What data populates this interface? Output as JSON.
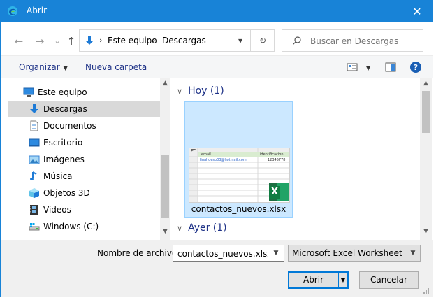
{
  "titlebar": {
    "title": "Abrir",
    "close": "✕"
  },
  "navigation": {
    "back": "←",
    "forward": "→",
    "recent": "⌄",
    "up": "↑",
    "breadcrumb": [
      "Este equipo",
      "Descargas"
    ],
    "breadcrumb_sep": "›",
    "refresh": "↻"
  },
  "search": {
    "placeholder": "Buscar en Descargas"
  },
  "toolbar": {
    "organize": "Organizar",
    "new_folder": "Nueva carpeta"
  },
  "tree": {
    "items": [
      {
        "label": "Este equipo",
        "icon": "computer-icon"
      },
      {
        "label": "Descargas",
        "icon": "downloads-icon"
      },
      {
        "label": "Documentos",
        "icon": "documents-icon"
      },
      {
        "label": "Escritorio",
        "icon": "desktop-icon"
      },
      {
        "label": "Imágenes",
        "icon": "pictures-icon"
      },
      {
        "label": "Música",
        "icon": "music-icon"
      },
      {
        "label": "Objetos 3D",
        "icon": "3d-objects-icon"
      },
      {
        "label": "Videos",
        "icon": "videos-icon"
      },
      {
        "label": "Windows (C:)",
        "icon": "drive-icon"
      }
    ]
  },
  "files": {
    "groups": [
      {
        "label": "Hoy (1)"
      },
      {
        "label": "Ayer (1)"
      }
    ],
    "selected_file": {
      "name": "contactos_nuevos.xlsx",
      "thumb_header": [
        "email",
        "identificacion"
      ],
      "thumb_row": [
        "linahueso03@hotmail.com",
        "12345778"
      ],
      "badge": "X"
    }
  },
  "bottom": {
    "filename_label": "Nombre de archivo:",
    "filename_value": "contactos_nuevos.xlsx",
    "filetype": "Microsoft Excel Worksheet (*.xl",
    "open": "Abrir",
    "cancel": "Cancelar"
  },
  "colors": {
    "accent": "#1883d7",
    "selection": "#cce8ff",
    "excel_green": "#1d6f42"
  }
}
